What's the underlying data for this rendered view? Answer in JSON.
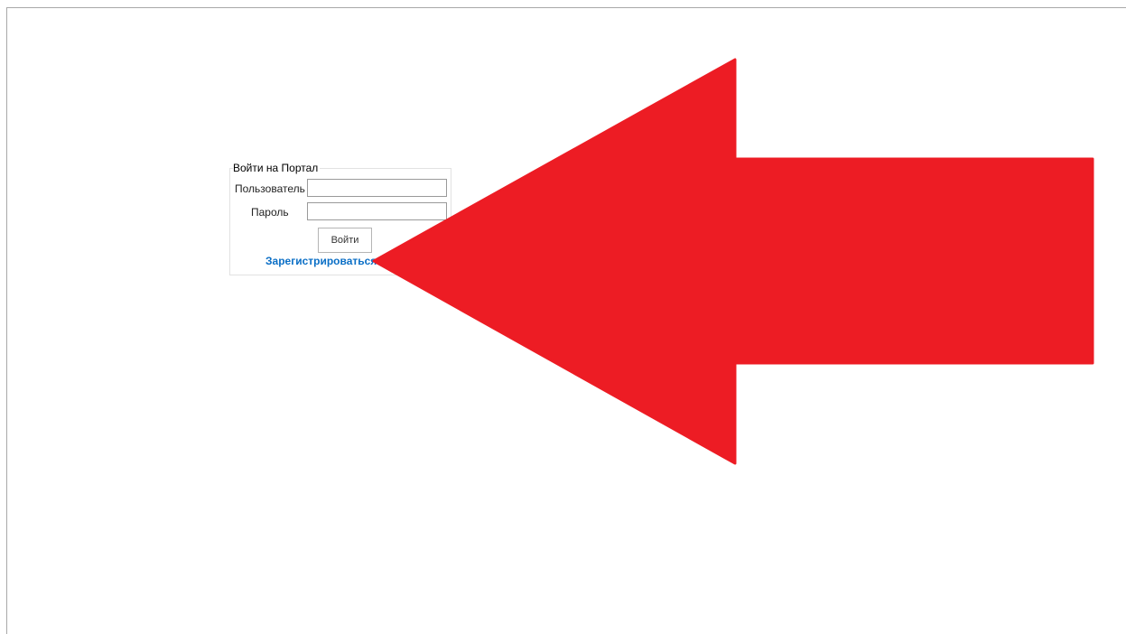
{
  "login_form": {
    "title": "Войти на Портал",
    "username_label": "Пользователь",
    "username_value": "",
    "password_label": "Пароль",
    "password_value": "",
    "submit_label": "Войти",
    "register_link": "Зарегистрироваться"
  },
  "annotation": {
    "arrow_color": "#ed1c24",
    "arrow_direction": "left"
  },
  "colors": {
    "link": "#0b6fc6",
    "frame_border": "#a8a8a8"
  }
}
